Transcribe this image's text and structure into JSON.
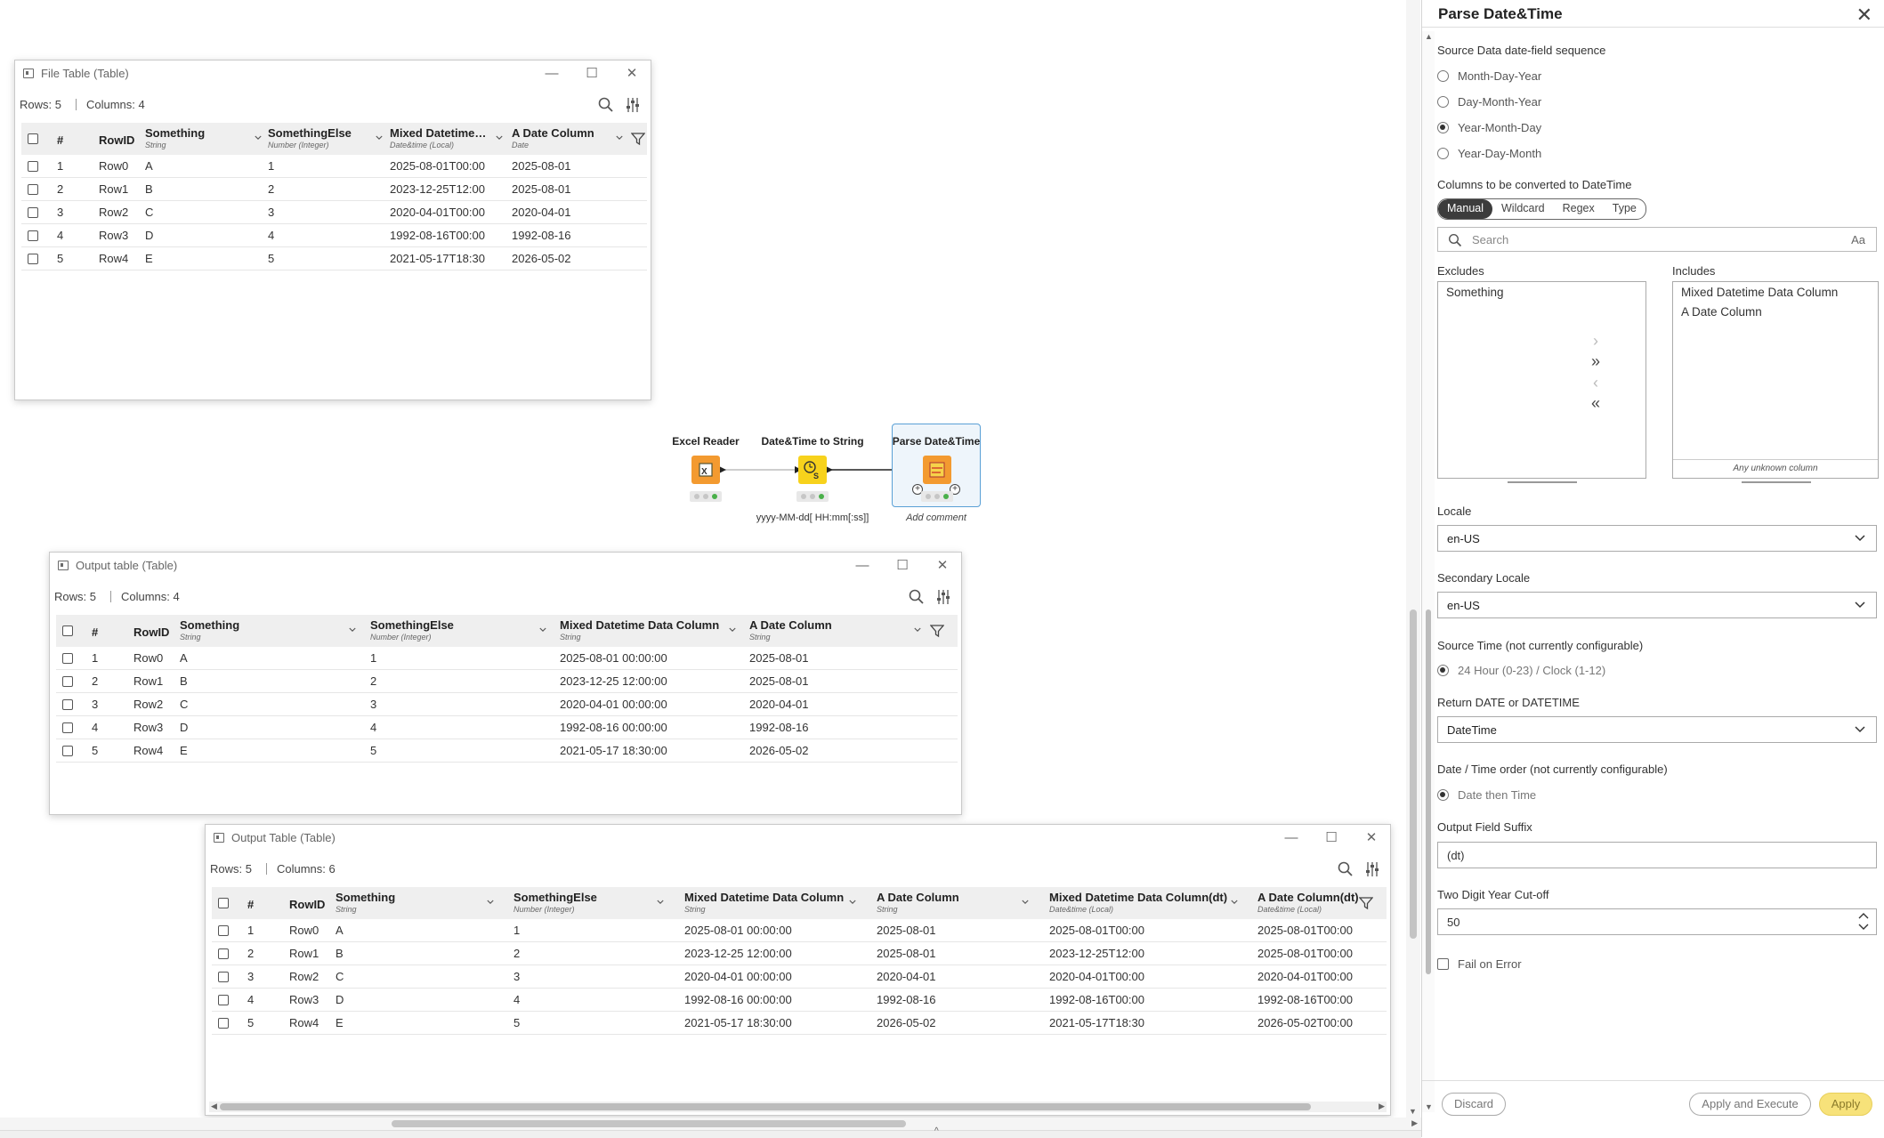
{
  "workflow": {
    "nodes": [
      {
        "label": "Excel Reader",
        "comment": ""
      },
      {
        "label": "Date&Time to String",
        "comment": "yyyy-MM-dd[ HH:mm[:ss]]"
      },
      {
        "label": "Parse Date&Time",
        "comment": "Add comment"
      }
    ]
  },
  "windows": {
    "file": {
      "title": "File Table (Table)",
      "rows_label": "Rows: 5",
      "cols_label": "Columns: 4",
      "columns": [
        {
          "name": "#",
          "type": ""
        },
        {
          "name": "RowID",
          "type": ""
        },
        {
          "name": "Something",
          "type": "String"
        },
        {
          "name": "SomethingElse",
          "type": "Number (Integer)"
        },
        {
          "name": "Mixed Datetime…",
          "type": "Date&time (Local)"
        },
        {
          "name": "A Date Column",
          "type": "Date"
        }
      ],
      "rows": [
        [
          "1",
          "Row0",
          "A",
          "1",
          "2025-08-01T00:00",
          "2025-08-01"
        ],
        [
          "2",
          "Row1",
          "B",
          "2",
          "2023-12-25T12:00",
          "2025-08-01"
        ],
        [
          "3",
          "Row2",
          "C",
          "3",
          "2020-04-01T00:00",
          "2020-04-01"
        ],
        [
          "4",
          "Row3",
          "D",
          "4",
          "1992-08-16T00:00",
          "1992-08-16"
        ],
        [
          "5",
          "Row4",
          "E",
          "5",
          "2021-05-17T18:30",
          "2026-05-02"
        ]
      ]
    },
    "output1": {
      "title": "Output table (Table)",
      "rows_label": "Rows: 5",
      "cols_label": "Columns: 4",
      "columns": [
        {
          "name": "#",
          "type": ""
        },
        {
          "name": "RowID",
          "type": ""
        },
        {
          "name": "Something",
          "type": "String"
        },
        {
          "name": "SomethingElse",
          "type": "Number (Integer)"
        },
        {
          "name": "Mixed Datetime Data Column",
          "type": "String"
        },
        {
          "name": "A Date Column",
          "type": "String"
        }
      ],
      "rows": [
        [
          "1",
          "Row0",
          "A",
          "1",
          "2025-08-01 00:00:00",
          "2025-08-01"
        ],
        [
          "2",
          "Row1",
          "B",
          "2",
          "2023-12-25 12:00:00",
          "2025-08-01"
        ],
        [
          "3",
          "Row2",
          "C",
          "3",
          "2020-04-01 00:00:00",
          "2020-04-01"
        ],
        [
          "4",
          "Row3",
          "D",
          "4",
          "1992-08-16 00:00:00",
          "1992-08-16"
        ],
        [
          "5",
          "Row4",
          "E",
          "5",
          "2021-05-17 18:30:00",
          "2026-05-02"
        ]
      ]
    },
    "output2": {
      "title": "Output Table (Table)",
      "rows_label": "Rows: 5",
      "cols_label": "Columns: 6",
      "columns": [
        {
          "name": "#",
          "type": ""
        },
        {
          "name": "RowID",
          "type": ""
        },
        {
          "name": "Something",
          "type": "String"
        },
        {
          "name": "SomethingElse",
          "type": "Number (Integer)"
        },
        {
          "name": "Mixed Datetime Data Column",
          "type": "String"
        },
        {
          "name": "A Date Column",
          "type": "String"
        },
        {
          "name": "Mixed Datetime Data Column(dt)",
          "type": "Date&time (Local)"
        },
        {
          "name": "A Date Column(dt)",
          "type": "Date&time (Local)"
        }
      ],
      "rows": [
        [
          "1",
          "Row0",
          "A",
          "1",
          "2025-08-01 00:00:00",
          "2025-08-01",
          "2025-08-01T00:00",
          "2025-08-01T00:00"
        ],
        [
          "2",
          "Row1",
          "B",
          "2",
          "2023-12-25 12:00:00",
          "2025-08-01",
          "2023-12-25T12:00",
          "2025-08-01T00:00"
        ],
        [
          "3",
          "Row2",
          "C",
          "3",
          "2020-04-01 00:00:00",
          "2020-04-01",
          "2020-04-01T00:00",
          "2020-04-01T00:00"
        ],
        [
          "4",
          "Row3",
          "D",
          "4",
          "1992-08-16 00:00:00",
          "1992-08-16",
          "1992-08-16T00:00",
          "1992-08-16T00:00"
        ],
        [
          "5",
          "Row4",
          "E",
          "5",
          "2021-05-17 18:30:00",
          "2026-05-02",
          "2021-05-17T18:30",
          "2026-05-02T00:00"
        ]
      ]
    }
  },
  "panel": {
    "title": "Parse Date&Time",
    "sequence_label": "Source Data date-field sequence",
    "sequence_options": [
      "Month-Day-Year",
      "Day-Month-Year",
      "Year-Month-Day",
      "Year-Day-Month"
    ],
    "sequence_selected": "Year-Month-Day",
    "columns_label": "Columns to be converted to DateTime",
    "modes": [
      "Manual",
      "Wildcard",
      "Regex",
      "Type"
    ],
    "mode_selected": "Manual",
    "search_placeholder": "Search",
    "case_toggle": "Aa",
    "excludes_label": "Excludes",
    "includes_label": "Includes",
    "excludes": [
      "Something"
    ],
    "includes": [
      "Mixed Datetime Data Column",
      "A Date Column"
    ],
    "unknown_column": "Any unknown column",
    "locale_label": "Locale",
    "locale_value": "en-US",
    "secondary_locale_label": "Secondary Locale",
    "secondary_locale_value": "en-US",
    "source_time_label": "Source Time (not currently configurable)",
    "source_time_option": "24 Hour (0-23) / Clock (1-12)",
    "return_label": "Return DATE or DATETIME",
    "return_value": "DateTime",
    "order_label": "Date / Time order (not currently configurable)",
    "order_option": "Date then Time",
    "suffix_label": "Output Field Suffix",
    "suffix_value": "(dt)",
    "cutoff_label": "Two Digit Year Cut-off",
    "cutoff_value": "50",
    "fail_label": "Fail on Error",
    "discard": "Discard",
    "apply_execute": "Apply and Execute",
    "apply": "Apply"
  }
}
